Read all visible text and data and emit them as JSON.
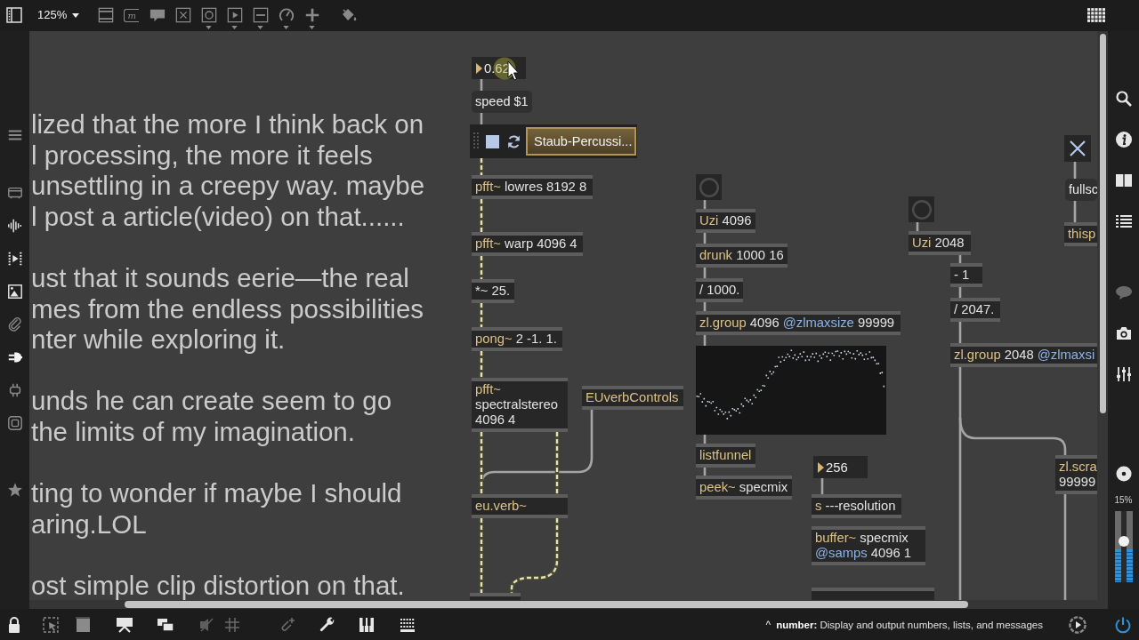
{
  "toolbar": {
    "zoom": "125%",
    "message_tool_label": "m"
  },
  "comment": {
    "paragraphs": [
      [
        "lized that the more I think back on",
        "l processing, the more it feels",
        "unsettling in a creepy way. maybe",
        "l post a article(video) on that......"
      ],
      [
        "ust that it sounds eerie—the real",
        "mes from the endless possibilities",
        "nter while exploring it."
      ],
      [
        "unds he can create seem to go",
        "the limits of my imagination."
      ],
      [
        "ting to wonder if maybe I should",
        "aring.LOL"
      ],
      [
        "ost simple clip distortion on that."
      ]
    ]
  },
  "patcher": {
    "objects": [
      {
        "kind": "number",
        "value": "0.62"
      },
      {
        "kind": "message",
        "text": "speed $1"
      },
      {
        "kind": "playlist",
        "clip": "Staub-Percussi..."
      },
      {
        "kind": "toggle",
        "checked": true
      },
      {
        "kind": "object",
        "lines": [
          [
            {
              "text": "pfft~",
              "kind": "class"
            },
            {
              "text": "lowres 8192 8",
              "kind": "arg"
            }
          ]
        ]
      },
      {
        "kind": "button"
      },
      {
        "kind": "object",
        "lines": [
          [
            {
              "text": "pfft~",
              "kind": "class"
            },
            {
              "text": "warp 4096 4",
              "kind": "arg"
            }
          ]
        ]
      },
      {
        "kind": "object",
        "lines": [
          [
            {
              "text": "Uzi",
              "kind": "class"
            },
            {
              "text": "4096",
              "kind": "arg"
            }
          ]
        ]
      },
      {
        "kind": "button"
      },
      {
        "kind": "message",
        "text": "fullsc"
      },
      {
        "kind": "object",
        "lines": [
          [
            {
              "text": "drunk",
              "kind": "class"
            },
            {
              "text": "1000 16",
              "kind": "arg"
            }
          ]
        ]
      },
      {
        "kind": "object",
        "lines": [
          [
            {
              "text": "Uzi",
              "kind": "class"
            },
            {
              "text": "2048",
              "kind": "arg"
            }
          ]
        ]
      },
      {
        "kind": "object",
        "lines": [
          [
            {
              "text": "thisp",
              "kind": "class"
            }
          ]
        ]
      },
      {
        "kind": "object",
        "lines": [
          [
            {
              "text": "*~",
              "kind": "operator"
            },
            {
              "text": "25.",
              "kind": "arg"
            }
          ]
        ]
      },
      {
        "kind": "object",
        "lines": [
          [
            {
              "text": "/",
              "kind": "operator"
            },
            {
              "text": "1000.",
              "kind": "arg"
            }
          ]
        ]
      },
      {
        "kind": "object",
        "lines": [
          [
            {
              "text": "-",
              "kind": "operator"
            },
            {
              "text": "1",
              "kind": "arg"
            }
          ]
        ]
      },
      {
        "kind": "object",
        "lines": [
          [
            {
              "text": "pong~",
              "kind": "class"
            },
            {
              "text": "2 -1. 1.",
              "kind": "arg"
            }
          ]
        ]
      },
      {
        "kind": "object",
        "lines": [
          [
            {
              "text": "zl.group",
              "kind": "class"
            },
            {
              "text": "4096",
              "kind": "arg"
            },
            {
              "text": "@zlmaxsize",
              "kind": "attr"
            },
            {
              "text": "99999",
              "kind": "arg"
            }
          ]
        ]
      },
      {
        "kind": "object",
        "lines": [
          [
            {
              "text": "/",
              "kind": "operator"
            },
            {
              "text": "2047.",
              "kind": "arg"
            }
          ]
        ]
      },
      {
        "kind": "object",
        "lines": [
          [
            {
              "text": "pfft~",
              "kind": "class"
            }
          ],
          [
            {
              "text": "spectralstereo",
              "kind": "arg"
            }
          ],
          [
            {
              "text": "4096 4",
              "kind": "arg"
            }
          ]
        ]
      },
      {
        "kind": "object",
        "lines": [
          [
            {
              "text": "EUverbControls",
              "kind": "class"
            }
          ]
        ]
      },
      {
        "kind": "multislider"
      },
      {
        "kind": "object",
        "lines": [
          [
            {
              "text": "zl.group",
              "kind": "class"
            },
            {
              "text": "2048",
              "kind": "arg"
            },
            {
              "text": "@zlmaxsi",
              "kind": "attr"
            }
          ]
        ]
      },
      {
        "kind": "object",
        "lines": [
          [
            {
              "text": "listfunnel",
              "kind": "class"
            }
          ]
        ]
      },
      {
        "kind": "object",
        "lines": [
          [
            {
              "text": "eu.verb~",
              "kind": "class"
            }
          ]
        ]
      },
      {
        "kind": "object",
        "lines": [
          [
            {
              "text": "peek~",
              "kind": "class"
            },
            {
              "text": "specmix",
              "kind": "arg"
            }
          ]
        ]
      },
      {
        "kind": "number",
        "value": "256"
      },
      {
        "kind": "object",
        "lines": [
          [
            {
              "text": "s",
              "kind": "class"
            },
            {
              "text": "---resolution",
              "kind": "arg"
            }
          ]
        ]
      },
      {
        "kind": "object",
        "lines": [
          [
            {
              "text": "zl.scra",
              "kind": "class"
            }
          ],
          [
            {
              "text": "99999",
              "kind": "arg"
            }
          ]
        ]
      },
      {
        "kind": "object",
        "lines": [
          [
            {
              "text": "buffer~",
              "kind": "class"
            },
            {
              "text": "specmix",
              "kind": "arg"
            }
          ],
          [
            {
              "text": "@samps",
              "kind": "attr"
            },
            {
              "text": "4096 1",
              "kind": "arg"
            }
          ]
        ]
      },
      {
        "kind": "object"
      },
      {
        "kind": "object"
      }
    ]
  },
  "right_sidebar": {
    "cpu_load": "15%",
    "gain": {
      "level": 0.58
    },
    "meters": [
      {
        "level": 0.46
      },
      {
        "level": 0.46
      }
    ]
  },
  "status_bar": {
    "expand": "^",
    "hint": "**number:** Display and output numbers, lists, and messages"
  }
}
